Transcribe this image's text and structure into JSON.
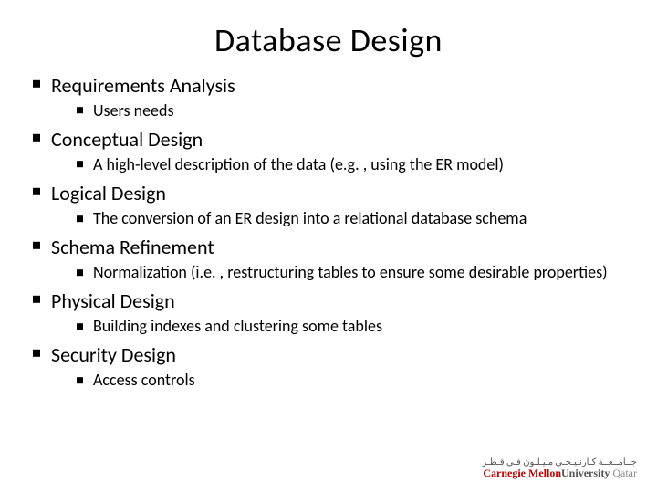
{
  "title": "Database Design",
  "items": [
    {
      "label": "Requirements Analysis",
      "sub": "Users needs"
    },
    {
      "label": "Conceptual Design",
      "sub": "A high-level description of the data (e.g. , using the ER model)"
    },
    {
      "label": "Logical Design",
      "sub": "The conversion of an ER design into a relational database schema"
    },
    {
      "label": "Schema Refinement",
      "sub": "Normalization (i.e. , restructuring tables to ensure some desirable properties)"
    },
    {
      "label": "Physical Design",
      "sub": "Building indexes and clustering some tables"
    },
    {
      "label": "Security Design",
      "sub": "Access controls"
    }
  ],
  "logo": {
    "arabic": "جــامــعــة كـارنـيـجـي مـيـلـون فـي قـطـر",
    "name": "Carnegie Mellon",
    "univ": "University",
    "loc": "Qatar"
  }
}
